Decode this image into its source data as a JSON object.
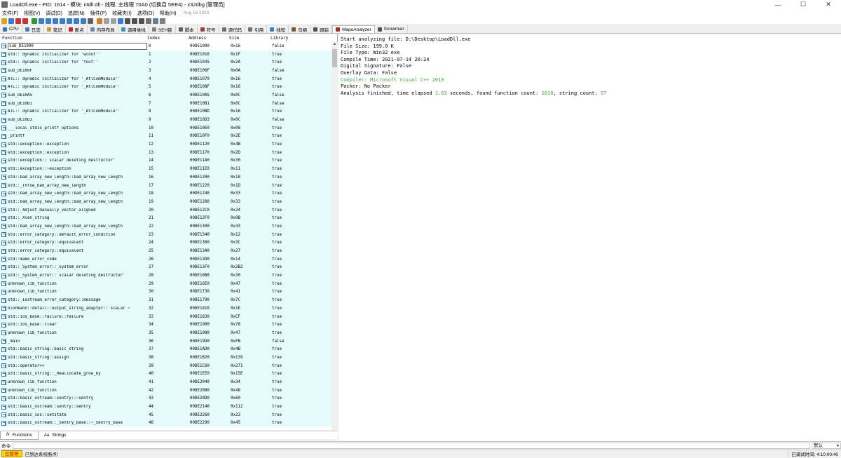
{
  "window": {
    "title": "LoadDll.exe - PID: 1614 - 模块: ntdll.dll - 线程: 主线程 70A0 (切换自 5EE4) - x32dbg [管理员]",
    "min": "—",
    "max": "☐",
    "close": "✕"
  },
  "menu": {
    "items": [
      "文件(F)",
      "视图(V)",
      "调试(D)",
      "追踪(N)",
      "插件(P)",
      "收藏夹(I)",
      "选项(O)",
      "帮助(H)"
    ],
    "date": "Aug 16 2020"
  },
  "toolbar": {
    "icons": [
      "open-icon",
      "restart-icon",
      "close-icon",
      "stop-icon",
      "run-icon",
      "pause-icon",
      "step-into-icon",
      "step-over-icon",
      "step-out-icon",
      "run-to-user-icon",
      "trace-into-icon",
      "trace-over-icon",
      "animate-icon",
      "patch-icon",
      "comment-icon",
      "label-icon",
      "bookmark-icon",
      "function-icon",
      "variable-icon",
      "font-icon",
      "calc-icon",
      "strings-icon",
      "settings-icon"
    ]
  },
  "tabs": [
    {
      "label": "CPU",
      "icon": "cpu-icon",
      "color": "#3a6fbf"
    },
    {
      "label": "日志",
      "icon": "log-icon",
      "color": "#4a7bd0"
    },
    {
      "label": "笔记",
      "icon": "notes-icon",
      "color": "#d09a30"
    },
    {
      "label": "断点",
      "icon": "breakpoint-icon",
      "color": "#d02020"
    },
    {
      "label": "内存布局",
      "icon": "memory-map-icon",
      "color": "#6a8ab0"
    },
    {
      "label": "调用堆栈",
      "icon": "call-stack-icon",
      "color": "#3a90d0"
    },
    {
      "label": "SEH链",
      "icon": "seh-icon",
      "color": "#808080"
    },
    {
      "label": "脚本",
      "icon": "script-icon",
      "color": "#606060"
    },
    {
      "label": "符号",
      "icon": "symbols-icon",
      "color": "#a04040"
    },
    {
      "label": "源代码",
      "icon": "source-icon",
      "color": "#707070"
    },
    {
      "label": "引用",
      "icon": "references-icon",
      "color": "#707070"
    },
    {
      "label": "线程",
      "icon": "threads-icon",
      "color": "#3a80c0"
    },
    {
      "label": "句柄",
      "icon": "handles-icon",
      "color": "#7a5a2a"
    },
    {
      "label": "跟踪",
      "icon": "trace-icon",
      "color": "#505050"
    },
    {
      "label": "MapoAnalyzer",
      "icon": "mapo-icon",
      "color": "#c02020"
    },
    {
      "label": "Snowman",
      "icon": "snowman-icon",
      "color": "#505050"
    }
  ],
  "functions_table": {
    "headers": [
      "Function",
      "Index",
      "Address",
      "Size",
      "Library"
    ],
    "rows": [
      [
        "sub_DE1000",
        "0",
        "00DE1000",
        "0x16",
        "false"
      ],
      [
        "std::`dynamic initializer for 'wcout''",
        "1",
        "00DE1016",
        "0x1F",
        "true"
      ],
      [
        "std::`dynamic initializer for 'fout''",
        "2",
        "00DE1035",
        "0x2A",
        "true"
      ],
      [
        "sub_DE106F",
        "3",
        "00DE106F",
        "0x0A",
        "false"
      ],
      [
        "ATL::`dynamic initializer for '_AtlComModule''",
        "4",
        "00DE1079",
        "0x16",
        "true"
      ],
      [
        "ATL::`dynamic initializer for '_AtlComModule''",
        "5",
        "00DE108F",
        "0x16",
        "true"
      ],
      [
        "sub_DE10A5",
        "6",
        "00DE10A5",
        "0x0C",
        "false"
      ],
      [
        "sub_DE10B1",
        "7",
        "00DE10B1",
        "0x0C",
        "false"
      ],
      [
        "ATL::`dynamic initializer for '_AtlComModule''",
        "8",
        "00DE10BD",
        "0x16",
        "true"
      ],
      [
        "sub_DE10D3",
        "9",
        "00DE10D3",
        "0x0C",
        "false"
      ],
      [
        "___local_stdio_printf_options",
        "10",
        "00DE10E0",
        "0x08",
        "true"
      ],
      [
        "_printf",
        "11",
        "00DE10F0",
        "0x2E",
        "true"
      ],
      [
        "std::exception::exception",
        "12",
        "00DE1120",
        "0x4B",
        "true"
      ],
      [
        "std::exception::exception",
        "13",
        "00DE1170",
        "0x2D",
        "true"
      ],
      [
        "std::exception::`scalar deleting destructor'",
        "14",
        "00DE11A0",
        "0x30",
        "true"
      ],
      [
        "std::exception::~exception",
        "15",
        "00DE11E0",
        "0x11",
        "true"
      ],
      [
        "std::bad_array_new_length::bad_array_new_length",
        "16",
        "00DE1200",
        "0x18",
        "true"
      ],
      [
        "std::_Throw_bad_array_new_length",
        "17",
        "00DE1220",
        "0x1D",
        "true"
      ],
      [
        "std::bad_array_new_length::bad_array_new_length",
        "18",
        "00DE1240",
        "0x33",
        "true"
      ],
      [
        "std::bad_array_new_length::bad_array_new_length",
        "19",
        "00DE1280",
        "0x33",
        "true"
      ],
      [
        "std::_Adjust_manually_vector_aligned",
        "20",
        "00DE12C0",
        "0x24",
        "true"
      ],
      [
        "std::_Xlen_string",
        "21",
        "00DE12F0",
        "0x0B",
        "true"
      ],
      [
        "std::bad_array_new_length::bad_array_new_length",
        "22",
        "00DE1300",
        "0x33",
        "true"
      ],
      [
        "std::error_category::default_error_condition",
        "23",
        "00DE1340",
        "0x12",
        "true"
      ],
      [
        "std::error_category::equivalent",
        "24",
        "00DE1360",
        "0x3C",
        "true"
      ],
      [
        "std::error_category::equivalent",
        "25",
        "00DE13A0",
        "0x27",
        "true"
      ],
      [
        "std::make_error_code",
        "26",
        "00DE13D0",
        "0x14",
        "true"
      ],
      [
        "std::_System_error::_System_error",
        "27",
        "00DE13F0",
        "0x2B2",
        "true"
      ],
      [
        "std::_System_error::`scalar deleting destructor'",
        "28",
        "00DE16B0",
        "0x30",
        "true"
      ],
      [
        "unknown_lib_function",
        "29",
        "00DE16E0",
        "0x47",
        "true"
      ],
      [
        "unknown_lib_function",
        "30",
        "00DE1730",
        "0x41",
        "true"
      ],
      [
        "std::_Iostream_error_category::message",
        "31",
        "00DE1790",
        "0x7C",
        "true"
      ],
      [
        "nlohmann::detail::output_string_adapter::`scalar ~",
        "32",
        "00DE1810",
        "0x1E",
        "true"
      ],
      [
        "std::ios_base::failure::failure",
        "33",
        "00DE1830",
        "0xCF",
        "true"
      ],
      [
        "std::ios_base::clear",
        "34",
        "00DE1900",
        "0x78",
        "true"
      ],
      [
        "unknown_lib_function",
        "35",
        "00DE1980",
        "0x47",
        "true"
      ],
      [
        "_main",
        "36",
        "00DE19D0",
        "0xFB",
        "false"
      ],
      [
        "std::basic_string::basic_string",
        "37",
        "00DE1AD0",
        "0x4B",
        "true"
      ],
      [
        "std::basic_string::assign",
        "38",
        "00DE1B20",
        "0x139",
        "true"
      ],
      [
        "std::operator<<",
        "39",
        "00DE1C60",
        "0x271",
        "true"
      ],
      [
        "std::basic_string::_Reallocate_grow_by",
        "40",
        "00DE1EE0",
        "0x15E",
        "true"
      ],
      [
        "unknown_lib_function",
        "41",
        "00DE2040",
        "0x34",
        "true"
      ],
      [
        "unknown_lib_function",
        "42",
        "00DE2080",
        "0x48",
        "true"
      ],
      [
        "std::basic_ostream::sentry::~sentry",
        "43",
        "00DE20D0",
        "0x60",
        "true"
      ],
      [
        "std::basic_ostream::sentry::sentry",
        "44",
        "00DE2140",
        "0x112",
        "true"
      ],
      [
        "std::basic_ios::setstate",
        "45",
        "00DE2260",
        "0x23",
        "true"
      ],
      [
        "std::basic_ostream::_Sentry_base::~_Sentry_base",
        "46",
        "00DE2290",
        "0x45",
        "true"
      ]
    ]
  },
  "bottom_tabs": {
    "functions": "Functions",
    "strings": "Strings",
    "functions_icon": "fx",
    "strings_icon": "Aa"
  },
  "analysis_log": {
    "file": "Start analyzing file: D:\\Desktop\\LoadDll.exe",
    "size": "File Size: 199.0 K",
    "type": "File Type: Win32 exe",
    "compile": "Compile Time: 2021-07-14 20:24",
    "signature": "Digital Signature: False",
    "overlay": "Overlay Data: False",
    "compiler_prefix": "Compiler: ",
    "compiler_value": "Microsoft Visual C++ 2019",
    "packer": "Packer: No Packer",
    "fin_prefix": "Analysis finished, time elapsed ",
    "fin_elapsed": "1.63",
    "fin_mid1": " seconds, found function count: ",
    "fin_func_count": "1010",
    "fin_mid2": ", string count: ",
    "fin_string_count": "97"
  },
  "command": {
    "label": "命令:",
    "value": "",
    "mode": "默认"
  },
  "status": {
    "state": "已暂停",
    "message": "已到达系统断点!",
    "elapsed_label": "已调试时间:",
    "elapsed": "4:10:00:40"
  },
  "colors": {
    "highlight_row": "#e6fbfb",
    "accent_green": "#38a838",
    "paused_badge": "#ffd800"
  }
}
